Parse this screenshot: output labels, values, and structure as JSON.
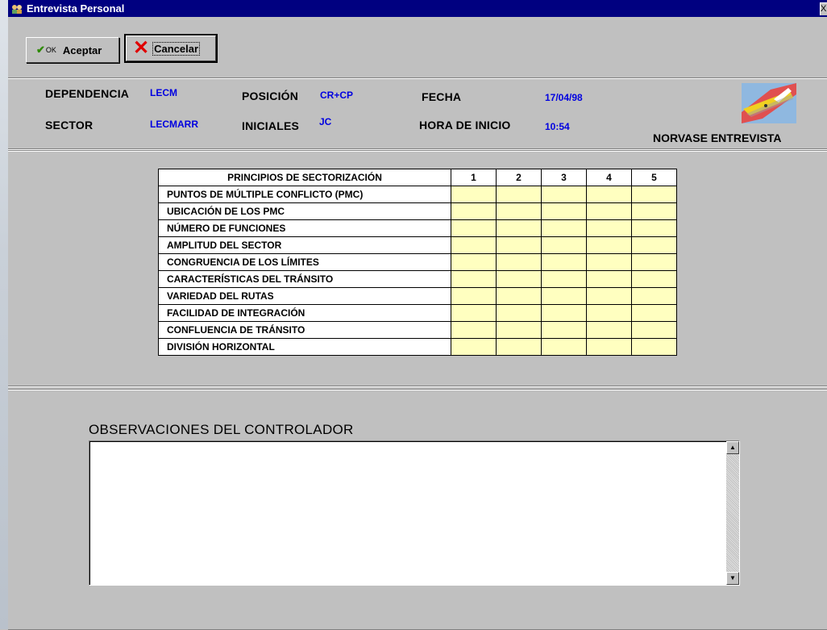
{
  "window": {
    "title": "Entrevista Personal",
    "close_label": "X"
  },
  "toolbar": {
    "accept_label": "Aceptar",
    "accept_icon_label": "OK",
    "cancel_label": "Cancelar"
  },
  "header": {
    "dependencia_label": "DEPENDENCIA",
    "dependencia_value": "LECM",
    "posicion_label": "POSICIÓN",
    "posicion_value": "CR+CP",
    "fecha_label": "FECHA",
    "fecha_value": "17/04/98",
    "sector_label": "SECTOR",
    "sector_value": "LECMARR",
    "iniciales_label": "INICIALES",
    "iniciales_value": "JC",
    "hora_label": "HORA DE INICIO",
    "hora_value": "10:54",
    "brand": "NORVASE ENTREVISTA"
  },
  "table": {
    "header": "PRINCIPIOS DE SECTORIZACIÓN",
    "scores": [
      "1",
      "2",
      "3",
      "4",
      "5"
    ],
    "rows": [
      "PUNTOS DE MÚLTIPLE CONFLICTO (PMC)",
      "UBICACIÓN DE LOS PMC",
      "NÚMERO DE FUNCIONES",
      "AMPLITUD DEL SECTOR",
      "CONGRUENCIA DE LOS LÍMITES",
      "CARACTERÍSTICAS DEL TRÁNSITO",
      "VARIEDAD DEL RUTAS",
      "FACILIDAD DE INTEGRACIÓN",
      "CONFLUENCIA DE TRÁNSITO",
      "DIVISIÓN HORIZONTAL"
    ]
  },
  "observations": {
    "title": "OBSERVACIONES DEL CONTROLADOR",
    "value": ""
  },
  "colors": {
    "titlebar": "#000080",
    "field_value": "#0000e0",
    "score_cell": "#ffffc0",
    "cancel_x": "#e00000",
    "check": "#2d8a00"
  }
}
